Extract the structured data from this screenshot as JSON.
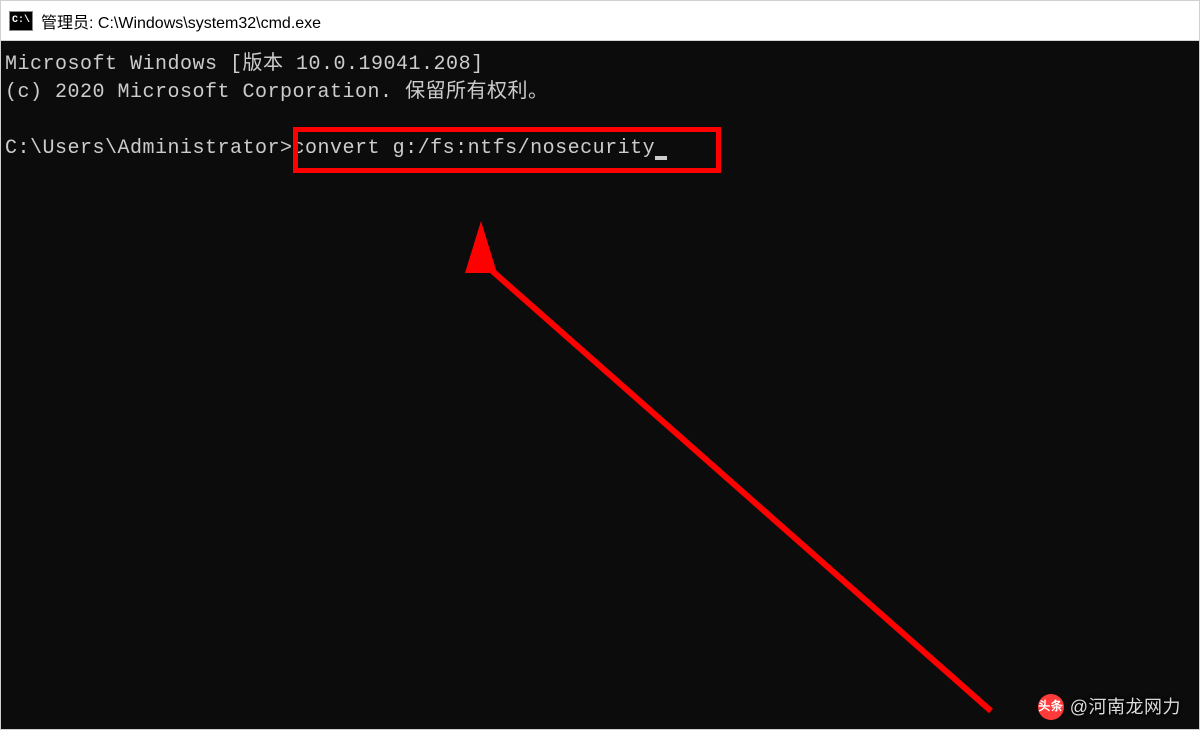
{
  "titlebar": {
    "icon_label": "C:\\",
    "title": "管理员: C:\\Windows\\system32\\cmd.exe"
  },
  "terminal": {
    "line1": "Microsoft Windows [版本 10.0.19041.208]",
    "line2": "(c) 2020 Microsoft Corporation. 保留所有权利。",
    "prompt": "C:\\Users\\Administrator>",
    "command": "convert g:/fs:ntfs/nosecurity"
  },
  "watermark": {
    "logo_text": "头条",
    "text": "@河南龙网力"
  },
  "colors": {
    "highlight": "#ff0000",
    "terminal_bg": "#0c0c0c",
    "terminal_fg": "#cccccc"
  }
}
